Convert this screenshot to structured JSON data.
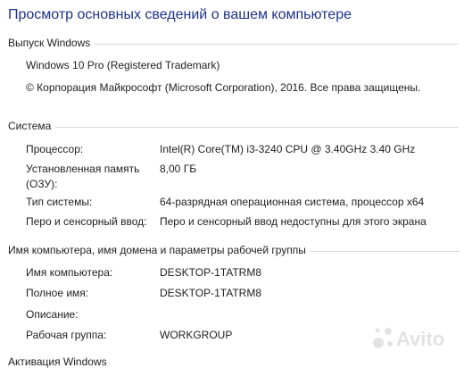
{
  "page": {
    "title": "Просмотр основных сведений о вашем компьютере"
  },
  "windows_edition": {
    "header": "Выпуск Windows",
    "edition": "Windows 10 Pro (Registered Trademark)",
    "copyright": "© Корпорация Майкрософт (Microsoft Corporation), 2016. Все права защищены."
  },
  "system": {
    "header": "Система",
    "rows": [
      {
        "label": "Процессор:",
        "value": "Intel(R) Core(TM) i3-3240 CPU @ 3.40GHz   3.40 GHz"
      },
      {
        "label": "Установленная память (ОЗУ):",
        "value": "8,00 ГБ"
      },
      {
        "label": "Тип системы:",
        "value": "64-разрядная операционная система, процессор x64"
      },
      {
        "label": "Перо и сенсорный ввод:",
        "value": "Перо и сенсорный ввод недоступны для этого экрана"
      }
    ]
  },
  "computer": {
    "header": "Имя компьютера, имя домена и параметры рабочей группы",
    "rows": [
      {
        "label": "Имя компьютера:",
        "value": "DESKTOP-1TATRM8"
      },
      {
        "label": "Полное имя:",
        "value": "DESKTOP-1TATRM8"
      },
      {
        "label": "Описание:",
        "value": ""
      },
      {
        "label": "Рабочая группа:",
        "value": "WORKGROUP"
      }
    ]
  },
  "next_section": {
    "header_partial": "Активация Windows"
  },
  "watermark": {
    "text": "Avito",
    "icon": "avito-logo-icon"
  },
  "colors": {
    "title": "#1e3287",
    "text": "#1e1e1e",
    "rule": "#d9d9d9"
  }
}
